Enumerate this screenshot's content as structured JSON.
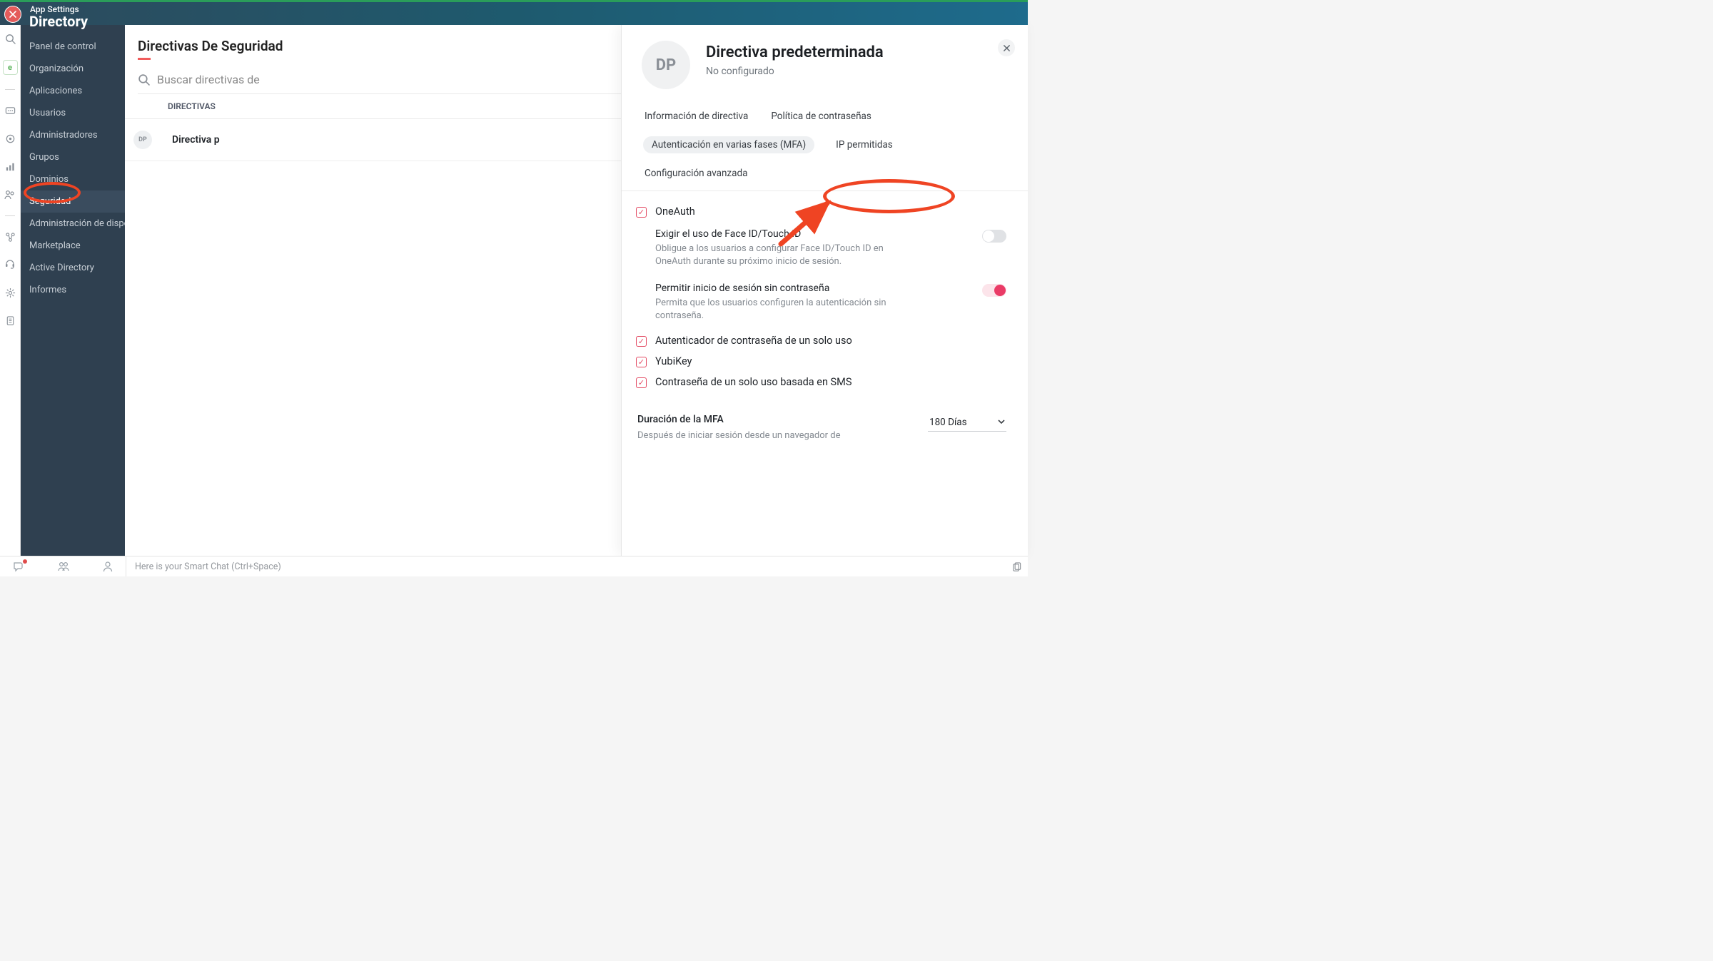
{
  "topbar": {
    "app_label": "App Settings",
    "section_title": "Directory"
  },
  "sidebar": {
    "items": [
      {
        "label": "Panel de control"
      },
      {
        "label": "Organización"
      },
      {
        "label": "Aplicaciones"
      },
      {
        "label": "Usuarios"
      },
      {
        "label": "Administradores"
      },
      {
        "label": "Grupos"
      },
      {
        "label": "Dominios"
      },
      {
        "label": "Seguridad"
      },
      {
        "label": "Administración de dispositivos"
      },
      {
        "label": "Marketplace"
      },
      {
        "label": "Active Directory"
      },
      {
        "label": "Informes"
      }
    ]
  },
  "main": {
    "heading": "Directivas De Seguridad",
    "search_placeholder": "Buscar directivas de",
    "tab_header": "DIRECTIVAS",
    "row": {
      "initials": "DP",
      "name": "Directiva p"
    }
  },
  "drawer": {
    "initials": "DP",
    "title": "Directiva predeterminada",
    "subtitle": "No configurado",
    "tabs": {
      "info": "Información de directiva",
      "password": "Política de contraseñas",
      "mfa": "Autenticación en varias fases (MFA)",
      "ip": "IP permitidas",
      "advanced": "Configuración avanzada"
    },
    "options": {
      "oneauth": {
        "label": "OneAuth",
        "faceid_title": "Exigir el uso de Face ID/Touch ID",
        "faceid_desc": "Obligue a los usuarios a configurar Face ID/Touch ID en OneAuth durante su próximo inicio de sesión.",
        "passwordless_title": "Permitir inicio de sesión sin contraseña",
        "passwordless_desc": "Permita que los usuarios configuren la autenticación sin contraseña."
      },
      "otp_auth": "Autenticador de contraseña de un solo uso",
      "yubikey": "YubiKey",
      "sms_otp": "Contraseña de un solo uso basada en SMS",
      "mfa_duration_title": "Duración de la MFA",
      "mfa_duration_desc": "Después de iniciar sesión desde un navegador de",
      "mfa_duration_value": "180 Días"
    }
  },
  "footer": {
    "chat_placeholder": "Here is your Smart Chat (Ctrl+Space)"
  }
}
